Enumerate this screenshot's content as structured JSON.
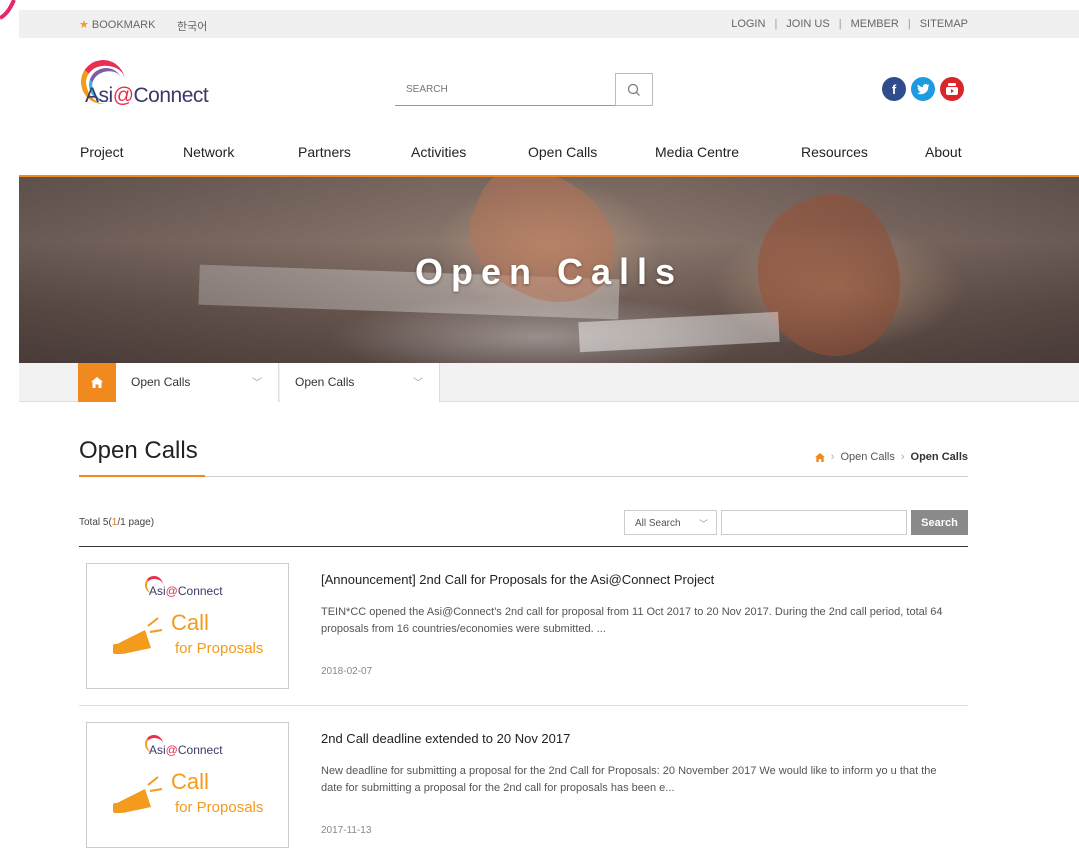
{
  "topbar": {
    "bookmark": "BOOKMARK",
    "korean": "한국어",
    "links": [
      "LOGIN",
      "JOIN US",
      "MEMBER",
      "SITEMAP"
    ]
  },
  "header": {
    "logo_prefix": "Asi",
    "logo_at": "@",
    "logo_suffix": "Connect",
    "search_placeholder": "SEARCH",
    "social": [
      "facebook-icon",
      "twitter-icon",
      "youtube-icon"
    ]
  },
  "nav": {
    "items": [
      "Project",
      "Network",
      "Partners",
      "Activities",
      "Open Calls",
      "Media Centre",
      "Resources",
      "About"
    ]
  },
  "banner": {
    "title": "Open Calls"
  },
  "subnav": {
    "dropdown1": "Open Calls",
    "dropdown2": "Open Calls"
  },
  "page": {
    "title": "Open Calls",
    "breadcrumb": [
      "Open Calls",
      "Open Calls"
    ]
  },
  "list": {
    "total_prefix": "Total 5(",
    "total_page": "1",
    "total_suffix": "/1 page)",
    "search_select": "All Search",
    "search_button": "Search"
  },
  "posts": [
    {
      "title": "[Announcement] 2nd Call for Proposals for the Asi@Connect Project",
      "desc": "TEIN*CC opened the Asi@Connect's 2nd call for proposal from 11 Oct 2017 to 20 Nov 2017. During the 2nd call period, total 64 proposals from 16 countries/economies were submitted.   ...",
      "date": "2018-02-07",
      "thumb": {
        "logo_prefix": "Asi",
        "logo_at": "@",
        "logo_suffix": "Connect",
        "call": "Call",
        "for": "for Proposals"
      }
    },
    {
      "title": "2nd Call deadline extended to 20 Nov 2017",
      "desc": "New deadline for submitting a proposal for the 2nd Call for Proposals: 20 November 2017 We would like to inform yo u that the date for submitting a proposal for the 2nd call for proposals has been e...",
      "date": "2017-11-13",
      "thumb": {
        "logo_prefix": "Asi",
        "logo_at": "@",
        "logo_suffix": "Connect",
        "call": "Call",
        "for": "for Proposals"
      }
    }
  ],
  "colors": {
    "accent": "#f08a1f",
    "brand_red": "#e6304f",
    "button_gray": "#8a8a8a"
  }
}
